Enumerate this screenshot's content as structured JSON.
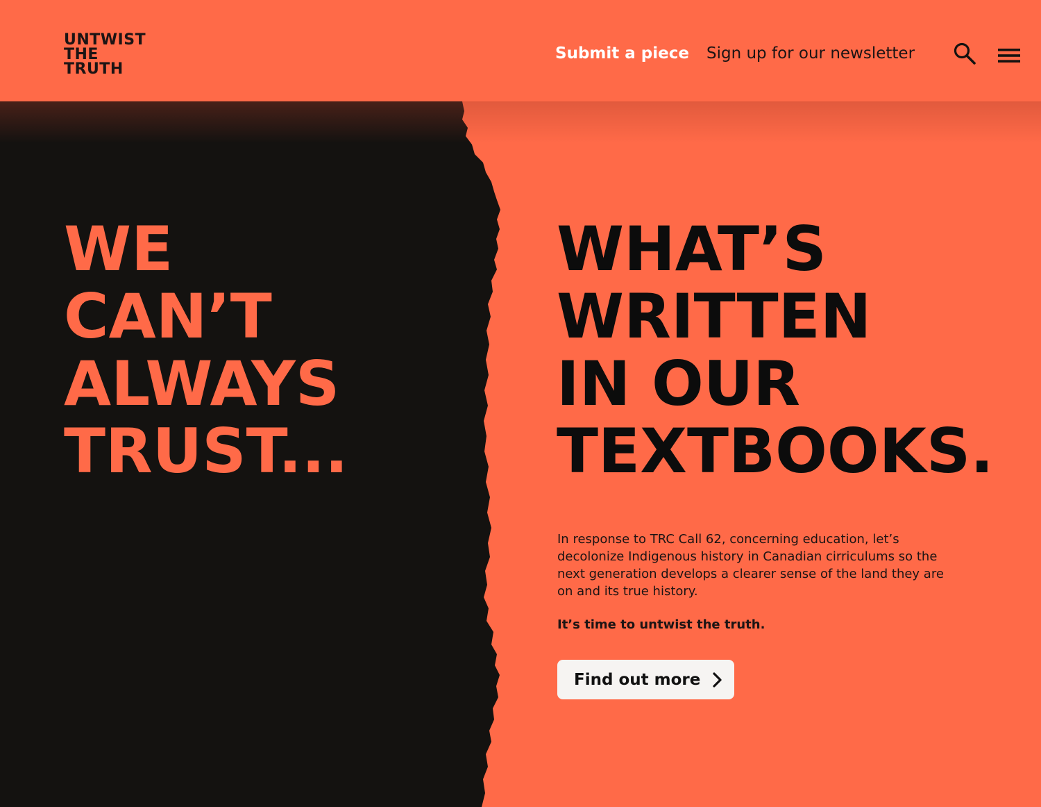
{
  "header": {
    "logo_lines": [
      "UNTWIST",
      "THE",
      "TRUTH"
    ],
    "nav": {
      "submit_label": "Submit a piece",
      "newsletter_label": "Sign up for our newsletter"
    },
    "icons": [
      "search-icon",
      "menu-icon"
    ]
  },
  "hero": {
    "left_headline": [
      "WE",
      "CAN’T",
      "ALWAYS",
      "TRUST..."
    ],
    "right_headline": [
      "WHAT’S",
      "WRITTEN",
      "IN OUR",
      "TEXTBOOKS."
    ],
    "intro": "In response to TRC Call 62, concerning education, let’s decolonize Indigenous history in Canadian cirriculums so the next generation develops a clearer sense of the land they are on and its true history.",
    "tagline": "It’s time to untwist the truth.",
    "cta_label": "Find out more"
  },
  "colors": {
    "accent": "#ff6a48",
    "dark": "#141210",
    "button": "#f6f4f2",
    "nav_highlight": "#ffffff"
  }
}
